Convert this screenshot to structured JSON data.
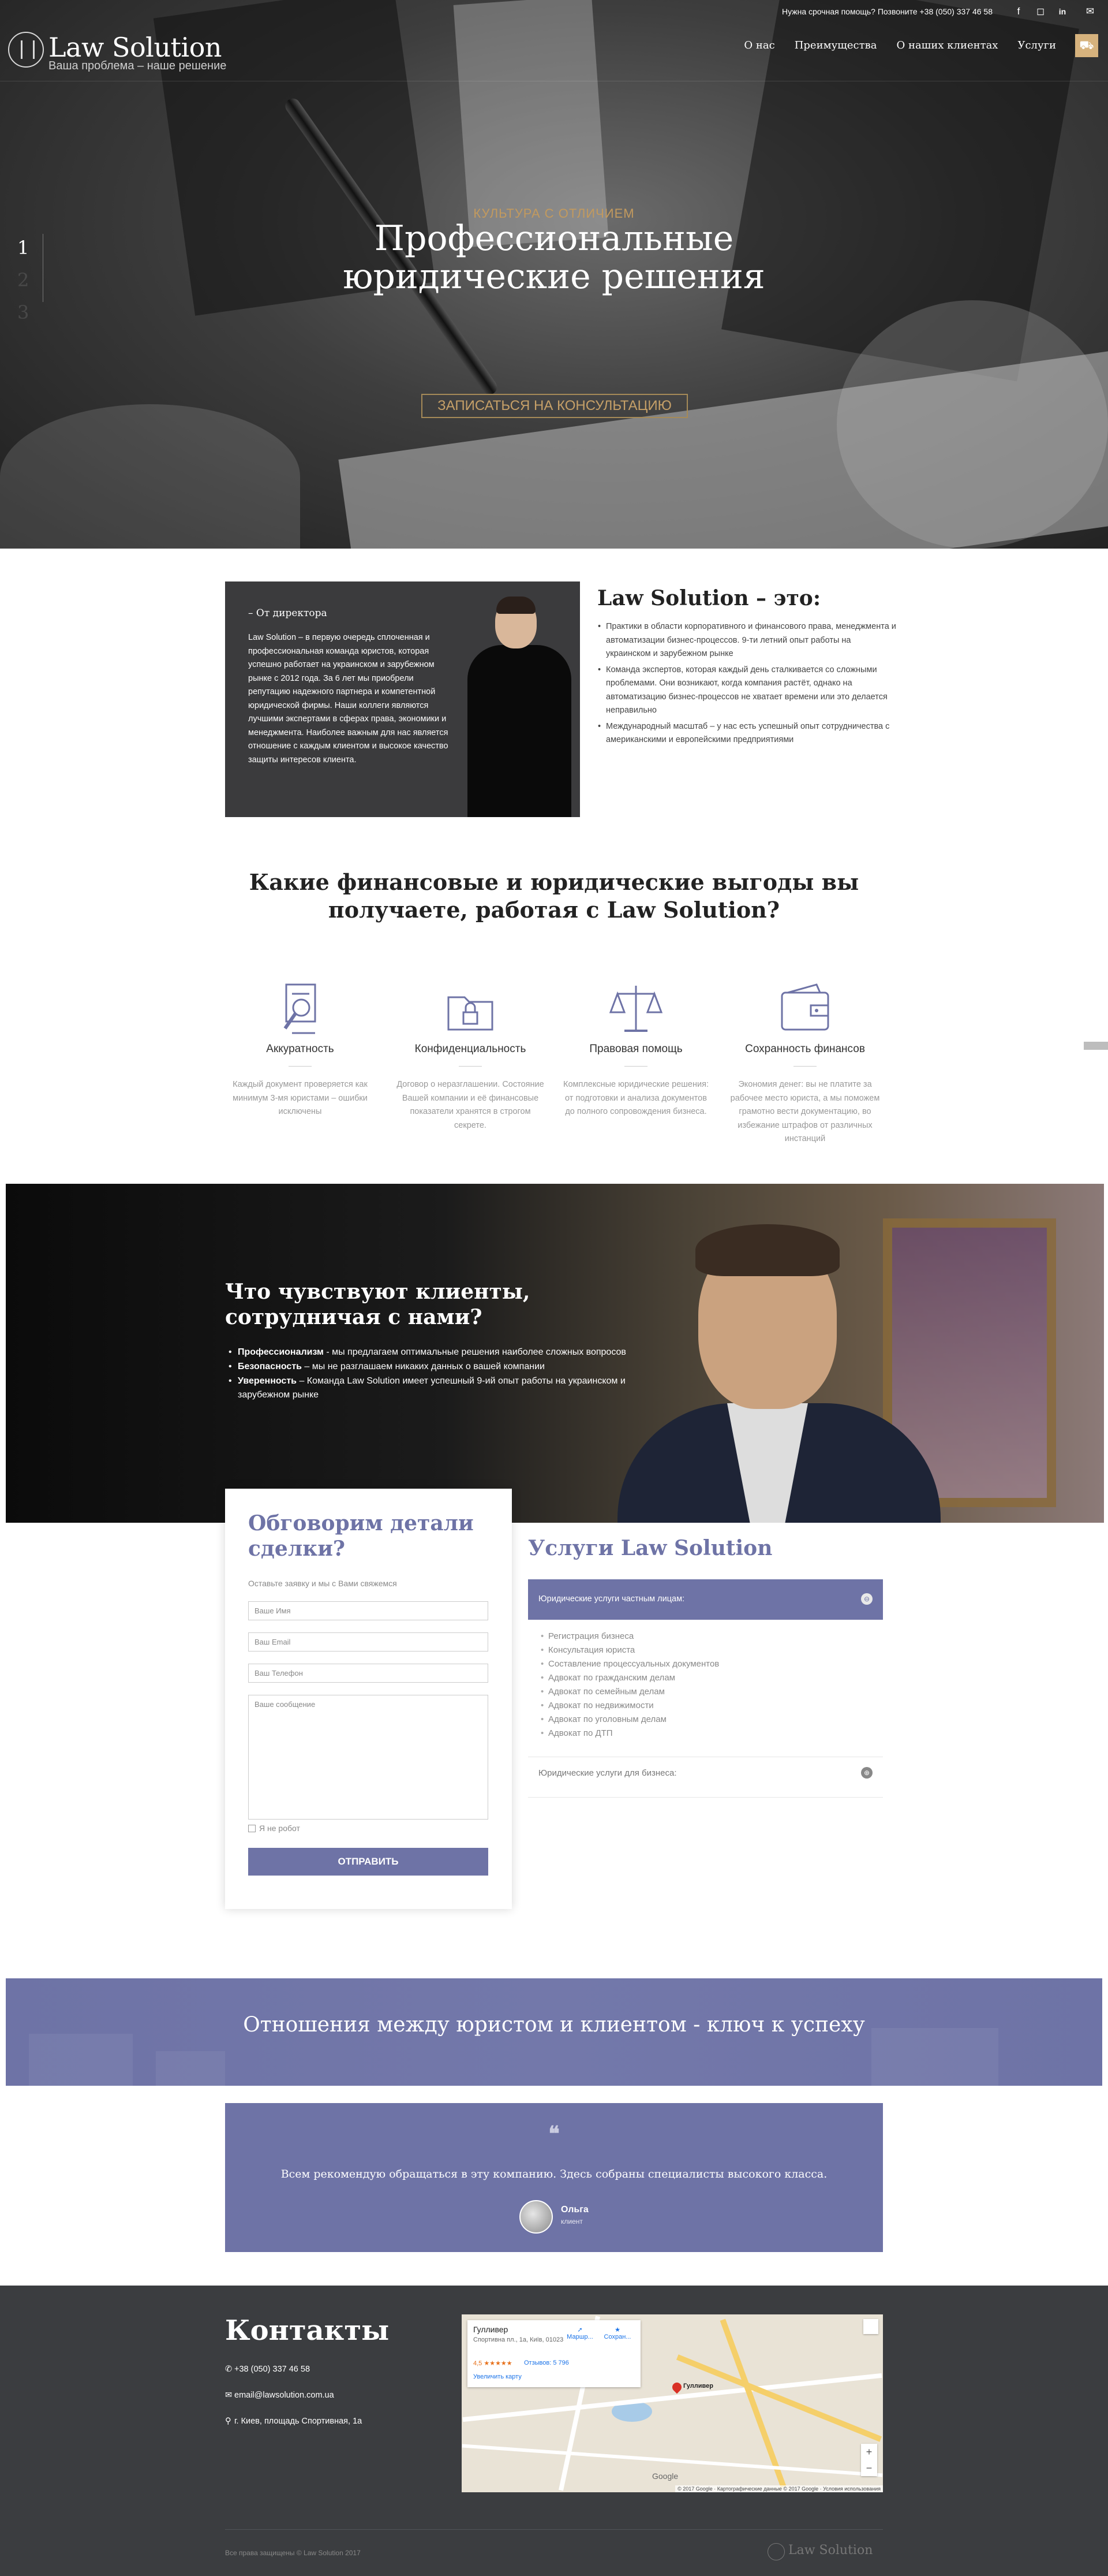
{
  "header": {
    "help_text": "Нужна срочная помощь? Позвоните +38 (050) 337 46 58",
    "logo_name": "Law Solution",
    "logo_tagline": "Ваша проблема – наше решение",
    "nav": [
      "О нас",
      "Преимущества",
      "О наших клиентах",
      "Услуги"
    ],
    "social_icons": [
      "facebook-icon",
      "instagram-icon",
      "linkedin-icon",
      "mail-icon"
    ],
    "cart_icon": "cart-icon"
  },
  "hero": {
    "slides": [
      "1",
      "2",
      "3"
    ],
    "active_slide": "1",
    "subtitle": "КУЛЬТУРА С ОТЛИЧИЕМ",
    "title_line1": "Профессиональные",
    "title_line2": "юридические решения",
    "cta": "ЗАПИСАТЬСЯ НА КОНСУЛЬТАЦИЮ"
  },
  "director": {
    "label": "– От директора",
    "text": "Law Solution – в первую очередь сплоченная и профессиональная команда юристов, которая успешно работает на украинском и зарубежном рынке с 2012 года. За 6 лет мы приобрели репутацию надежного партнера и компетентной юридической фирмы. Наши коллеги являются лучшими экспертами в сферах права, экономики и менеджмента. Наиболее важным для нас является отношение с каждым клиентом и высокое качество защиты интересов клиента."
  },
  "about": {
    "title": "Law Solution – это:",
    "items": [
      "Практики в области корпоративного и финансового права, менеджмента и автоматизации бизнес-процессов. 9-ти летний опыт работы на украинском и зарубежном рынке",
      "Команда экспертов, которая каждый день сталкивается со сложными проблемами. Они возникают, когда компания растёт, однако на автоматизацию бизнес-процессов не хватает времени или это делается неправильно",
      "Международный масштаб – у нас есть успешный опыт сотрудничества с американскими и европейскими предприятиями"
    ]
  },
  "benefits": {
    "title": "Какие финансовые и юридические выгоды вы получаете, работая с Law Solution?",
    "items": [
      {
        "title": "Аккуратность",
        "text": "Каждый документ проверяется как минимум 3-мя юристами – ошибки исключены",
        "icon": "document-search-icon"
      },
      {
        "title": "Конфиденциальность",
        "text": "Договор о неразглашении. Состояние Вашей компании и её финансовые показатели хранятся в строгом секрете.",
        "icon": "locked-folder-icon"
      },
      {
        "title": "Правовая помощь",
        "text": "Комплексные юридические решения: от подготовки и анализа документов до полного сопровождения бизнеса.",
        "icon": "scales-icon"
      },
      {
        "title": "Сохранность финансов",
        "text": "Экономия денег: вы не платите за рабочее место юриста, а мы поможем грамотно вести документацию, во избежание штрафов от различных инстанций",
        "icon": "wallet-icon"
      }
    ]
  },
  "clients": {
    "title": "Что чувствуют клиенты, сотрудничая с нами?",
    "items": [
      {
        "bold": "Профессионализм",
        "text": " - мы предлагаем оптимальные решения наиболее сложных вопросов"
      },
      {
        "bold": "Безопасность",
        "text": " – мы не разглашаем никаких данных о вашей компании"
      },
      {
        "bold": "Уверенность",
        "text": " – Команда Law Solution имеет успешный 9-ий опыт работы на украинском и зарубежном рынке"
      }
    ]
  },
  "form": {
    "title": "Обговорим детали сделки?",
    "hint": "Оставьте заявку и мы с Вами свяжемся",
    "name_placeholder": "Ваше Имя",
    "email_placeholder": "Ваш Email",
    "phone_placeholder": "Ваш Телефон",
    "message_placeholder": "Ваше сообщение",
    "captcha_label": "Я не робот",
    "submit": "ОТПРАВИТЬ"
  },
  "services": {
    "title": "Услуги Law Solution",
    "private_header": "Юридические услуги частным лицам:",
    "private_items": [
      "Регистрация бизнеса",
      "Консультация юриста",
      "Составление процессуальных документов",
      "Адвокат по гражданским делам",
      "Адвокат по семейным делам",
      "Адвокат по недвижимости",
      "Адвокат по уголовным делам",
      "Адвокат по ДТП"
    ],
    "business_header": "Юридические услуги для бизнеса:"
  },
  "banner": {
    "text": "Отношения между юристом и клиентом - ключ к успеху"
  },
  "testimonial": {
    "quote_mark": "❝",
    "text": "Всем рекомендую обращаться в эту компанию. Здесь собраны специалисты высокого класса.",
    "name": "Ольга",
    "role": "клиент"
  },
  "footer": {
    "title": "Контакты",
    "phone": "+38 (050) 337 46 58",
    "email": "email@lawsolution.com.ua",
    "address": "г. Киев, площадь Спортивная, 1а",
    "rights": "Все права защищены © Law Solution 2017",
    "logo": "Law Solution",
    "map": {
      "place": "Гулливер",
      "address": "Спортивна пл., 1а, Київ, 01023",
      "rating": "4,5 ★★★★★",
      "reviews": "Отзывов: 5 796",
      "enlarge": "Увеличить карту",
      "route": "Маршр...",
      "save": "Сохран...",
      "pin_label": "Гулливер",
      "google": "Google",
      "copyright": "© 2017 Google · Картографические данные © 2017 Google · Условия использования"
    }
  },
  "colors": {
    "accent": "#6e73a6",
    "gold": "#c39a5e",
    "footer": "#3b3d40"
  }
}
